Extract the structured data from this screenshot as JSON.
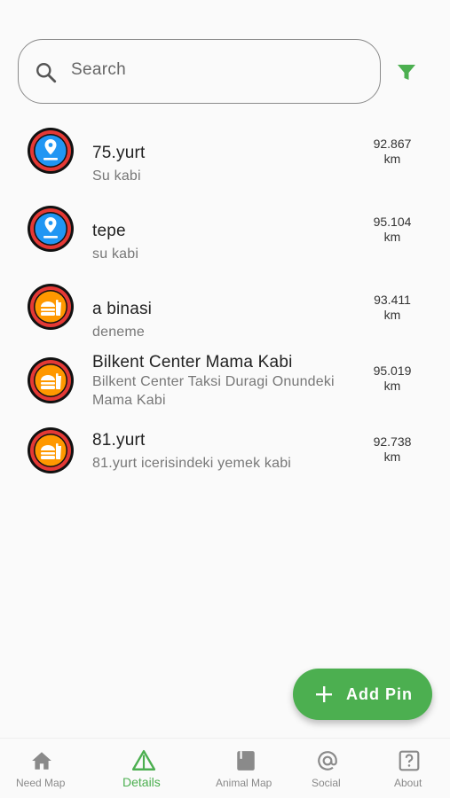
{
  "search": {
    "placeholder": "Search"
  },
  "colors": {
    "accent": "#4caf50",
    "water_pin": "#2196f3",
    "food_pin": "#ff9800",
    "ring": "#e53935"
  },
  "items": [
    {
      "title": "75.yurt",
      "subtitle": "Su kabi",
      "distance": "92.867",
      "unit": "km",
      "icon": "location-pin-icon"
    },
    {
      "title": "tepe",
      "subtitle": "su kabi",
      "distance": "95.104",
      "unit": "km",
      "icon": "location-pin-icon"
    },
    {
      "title": "a binasi",
      "subtitle": "deneme",
      "distance": "93.411",
      "unit": "km",
      "icon": "food-icon"
    },
    {
      "title": "Bilkent Center Mama Kabi",
      "subtitle": "Bilkent Center Taksi Duragi Onundeki Mama Kabi",
      "distance": "95.019",
      "unit": "km",
      "icon": "food-icon"
    },
    {
      "title": "81.yurt",
      "subtitle": "81.yurt icerisindeki yemek kabi",
      "distance": "92.738",
      "unit": "km",
      "icon": "food-icon"
    }
  ],
  "fab": {
    "label": "Add Pin"
  },
  "nav": [
    {
      "label": "Need Map",
      "icon": "home-icon"
    },
    {
      "label": "Details",
      "icon": "warning-triangle-icon",
      "active": true
    },
    {
      "label": "Animal Map",
      "icon": "book-icon"
    },
    {
      "label": "Social",
      "icon": "at-sign-icon"
    },
    {
      "label": "About",
      "icon": "help-box-icon"
    }
  ]
}
